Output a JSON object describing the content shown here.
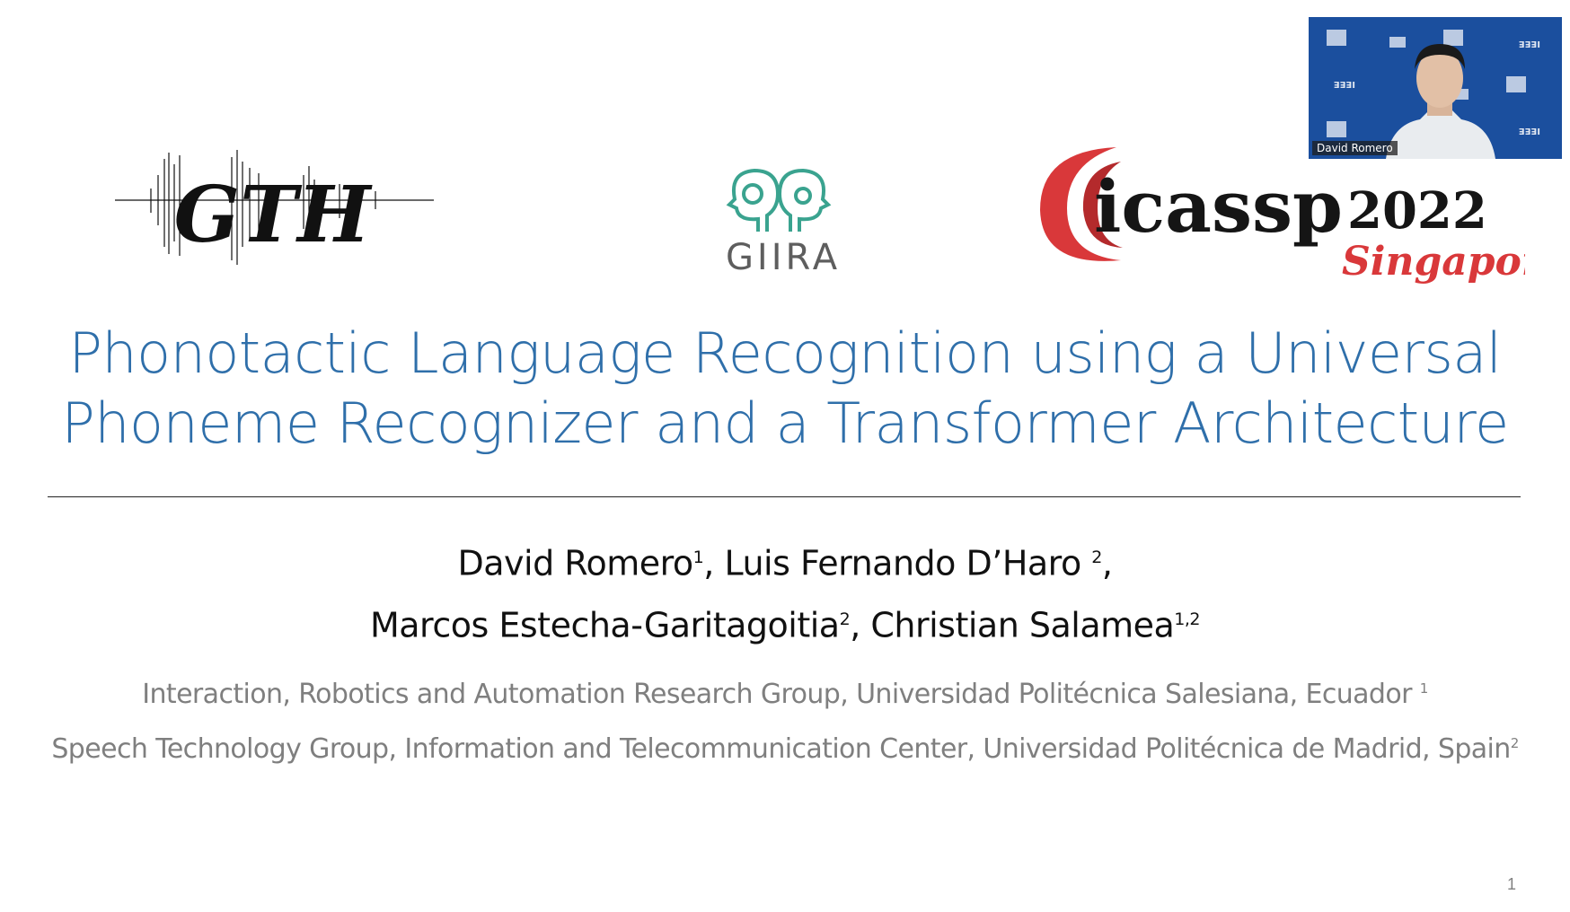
{
  "logos": {
    "gth": "GTH",
    "giira": "GIIRA",
    "icassp": "icassp",
    "year": "2022",
    "city": "Singapore"
  },
  "video": {
    "participant_name": "David Romero",
    "background_logo": "IEEE"
  },
  "slide": {
    "title_line1": "Phonotactic Language Recognition using a Universal",
    "title_line2": "Phoneme Recognizer and a Transformer Architecture",
    "authors": [
      {
        "name": "David Romero",
        "sup": "1",
        "sep": ", "
      },
      {
        "name": "Luis Fernando D’Haro ",
        "sup": "2",
        "sep": ","
      },
      {
        "name": "Marcos Estecha-Garitagoitia",
        "sup": "2",
        "sep": ", "
      },
      {
        "name": "Christian Salamea",
        "sup": "1,2",
        "sep": ""
      }
    ],
    "affiliation1": "Interaction, Robotics and Automation Research Group, Universidad Politécnica Salesiana, Ecuador ",
    "affiliation1_sup": "1",
    "affiliation2": "Speech Technology Group, Information and Telecommunication Center, Universidad Politécnica de Madrid, Spain",
    "affiliation2_sup": "2",
    "page_number": "1"
  },
  "colors": {
    "title": "#2f6faa",
    "icassp_red": "#d9383a",
    "giira_green": "#3aa38f",
    "video_bg": "#1b4f9e"
  }
}
